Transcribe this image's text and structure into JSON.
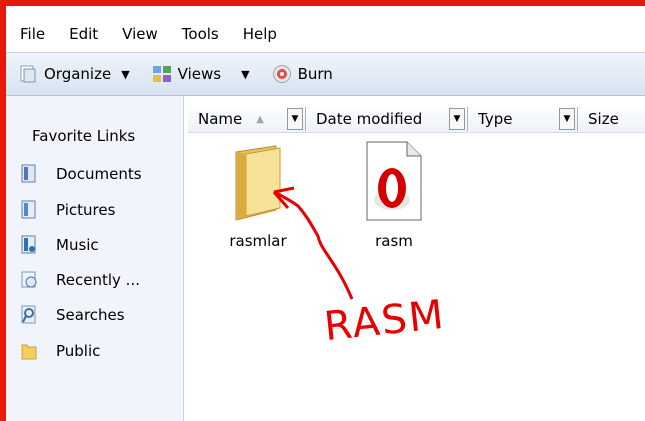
{
  "menu": [
    "File",
    "Edit",
    "View",
    "Tools",
    "Help"
  ],
  "toolbar": {
    "organize": "Organize",
    "views": "Views",
    "burn": "Burn"
  },
  "sidebar": {
    "title": "Favorite Links",
    "links": [
      "Documents",
      "Pictures",
      "Music",
      "Recently ...",
      "Searches",
      "Public"
    ]
  },
  "columns": [
    "Name",
    "Date modified",
    "Type",
    "Size"
  ],
  "files": [
    {
      "name": "rasmlar",
      "icon": "folder-icon"
    },
    {
      "name": "rasm",
      "icon": "opera-file-icon"
    }
  ],
  "annotation": "RASM",
  "colors": {
    "frame": "#e61a0a",
    "annotation": "#e60000"
  }
}
